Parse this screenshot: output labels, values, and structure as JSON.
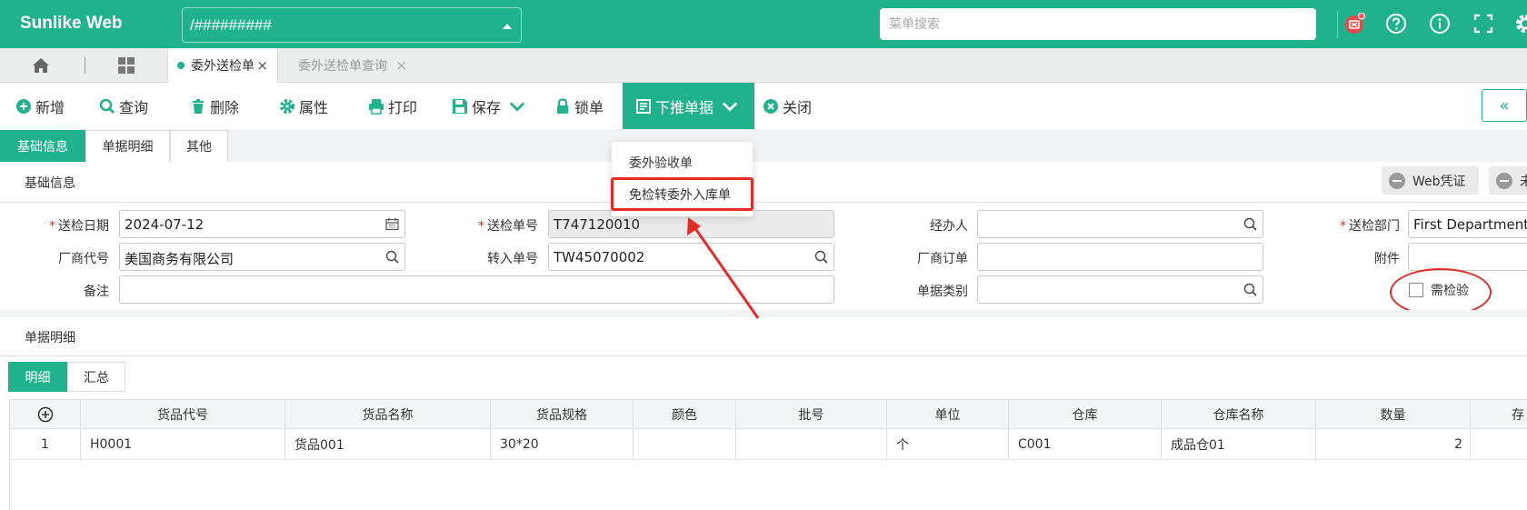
{
  "header": {
    "brand": "Sunlike Web",
    "path_value": "/#########",
    "search_placeholder": "菜单搜索",
    "accent": "#1fb28c"
  },
  "tabs": {
    "items": [
      {
        "label": "委外送检单",
        "active": true
      },
      {
        "label": "委外送检单查询",
        "active": false
      }
    ]
  },
  "toolbar": {
    "add": "新增",
    "query": "查询",
    "delete": "删除",
    "properties": "属性",
    "print": "打印",
    "save": "保存",
    "lock": "锁单",
    "push_down": "下推单据",
    "close": "关闭",
    "collapse_glyph": "«"
  },
  "push_menu": {
    "items": [
      "委外验收单",
      "免检转委外入库单"
    ],
    "highlight_color": "#e52b23"
  },
  "section_tabs": [
    "基础信息",
    "单据明细",
    "其他"
  ],
  "basic": {
    "title": "基础信息",
    "web_voucher": "Web凭证",
    "second_button_partial": "未",
    "fields": {
      "send_date_label": "送检日期",
      "send_date": "2024-07-12",
      "send_no_label": "送检单号",
      "send_no": "T747120010",
      "handler_label": "经办人",
      "handler": "",
      "dept_label": "送检部门",
      "dept": "First Department",
      "vendor_label": "厂商代号",
      "vendor": "美国商务有限公司",
      "transfer_no_label": "转入单号",
      "transfer_no": "TW45070002",
      "vendor_order_label": "厂商订单",
      "vendor_order": "",
      "attachment_label": "附件",
      "attachment": "",
      "remark_label": "备注",
      "remark": "",
      "doc_type_label": "单据类别",
      "doc_type": "",
      "need_inspect_label": "需检验",
      "need_inspect": false
    }
  },
  "detail": {
    "title": "单据明细",
    "sub_tabs": [
      "明细",
      "汇总"
    ],
    "columns": [
      "货品代号",
      "货品名称",
      "货品规格",
      "颜色",
      "批号",
      "单位",
      "仓库",
      "仓库名称",
      "数量",
      "存"
    ],
    "rows": [
      {
        "no": "1",
        "code": "H0001",
        "name": "货品001",
        "spec": "30*20",
        "color": "",
        "batch": "",
        "unit": "个",
        "wh": "C001",
        "wh_name": "成品仓01",
        "qty": "2",
        "extra": ""
      }
    ]
  }
}
